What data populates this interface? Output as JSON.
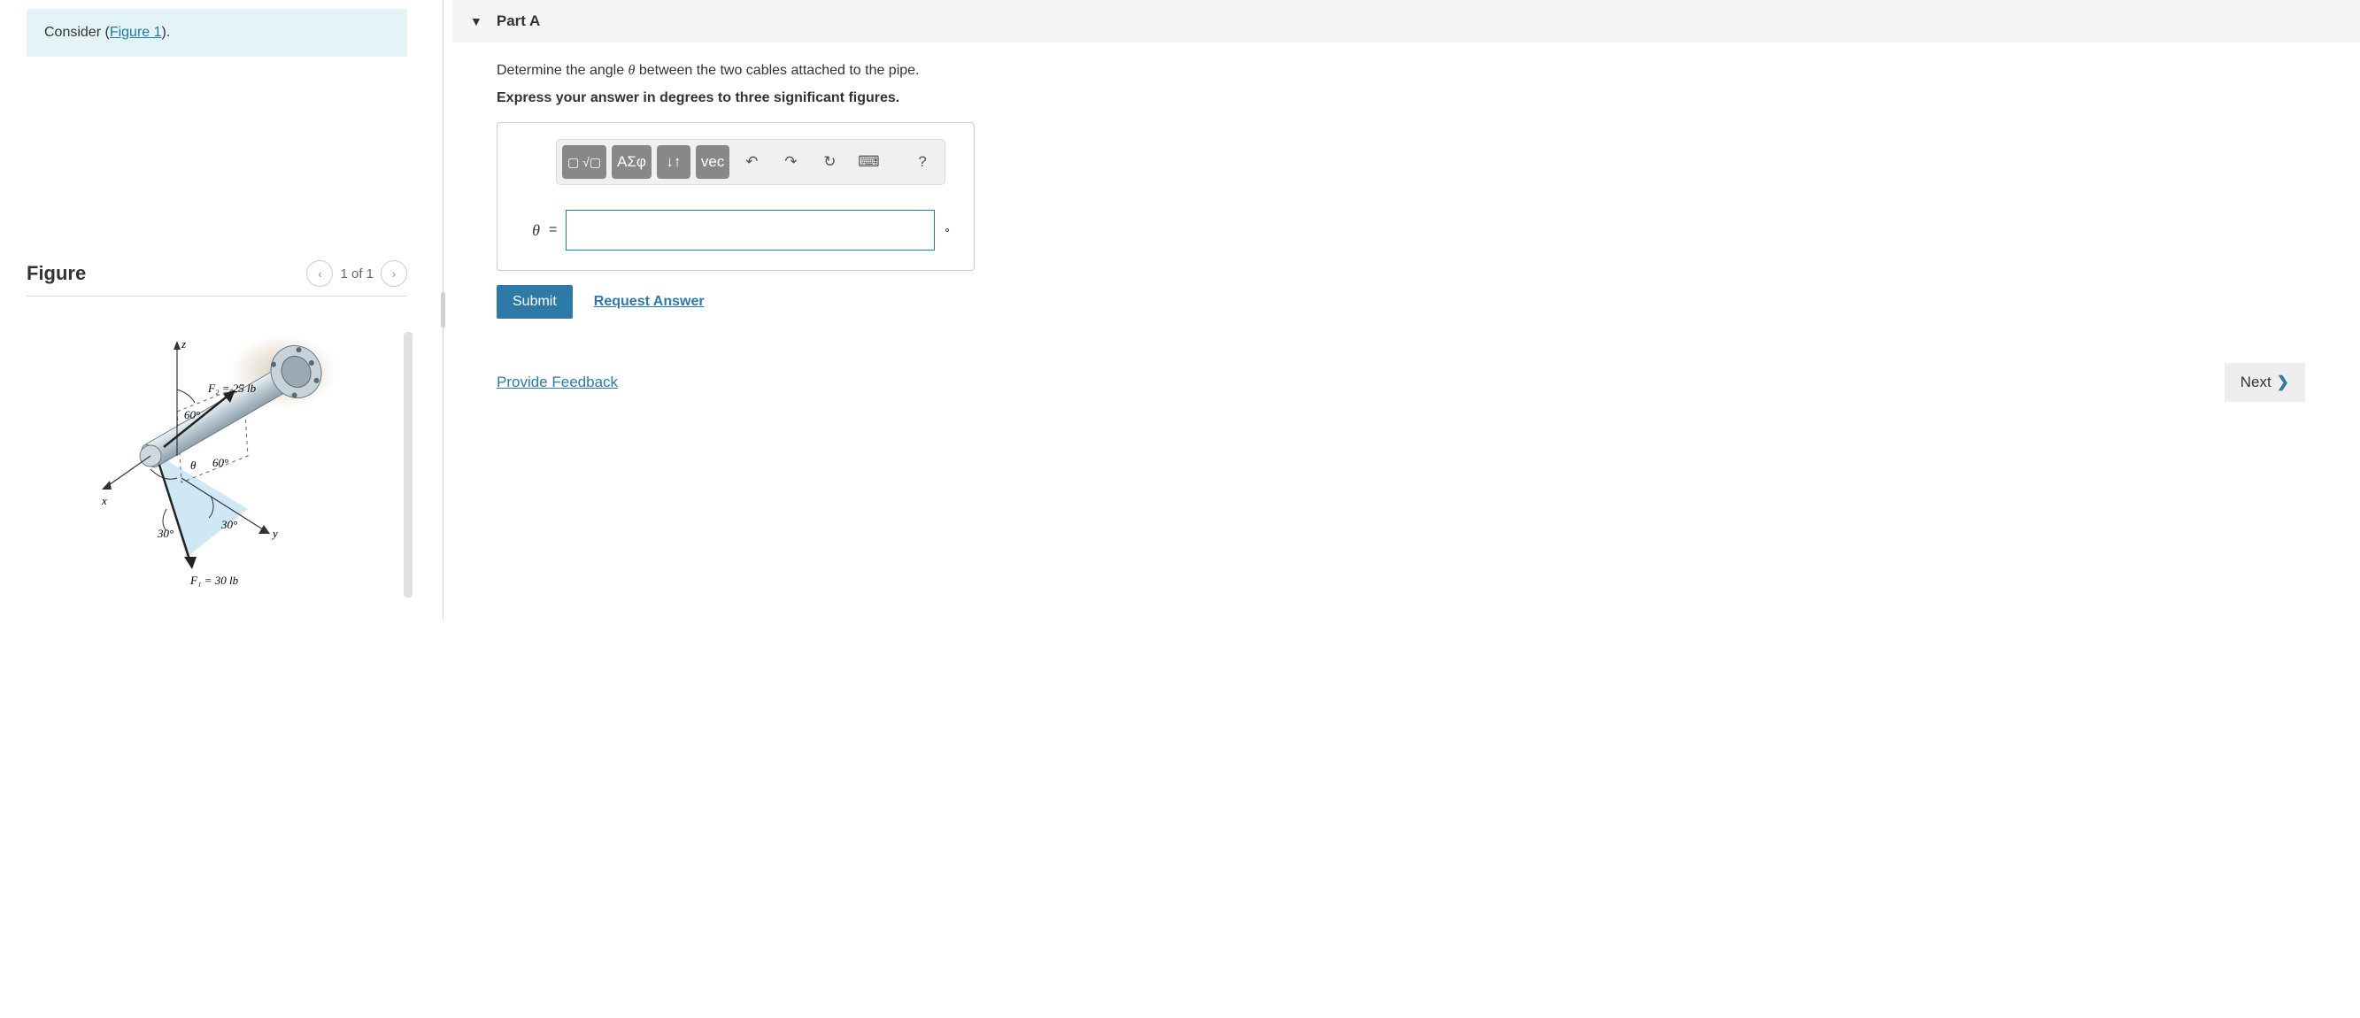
{
  "consider": {
    "prefix": "Consider (",
    "link_text": "Figure 1",
    "suffix": ")."
  },
  "figure": {
    "title": "Figure",
    "nav_label": "1 of 1",
    "labels": {
      "z": "z",
      "x": "x",
      "y": "y",
      "f2": "F₂ = 25 lb",
      "f1": "F₁ = 30 lb",
      "ang60a": "60°",
      "ang60b": "60°",
      "ang30a": "30°",
      "ang30b": "30°",
      "theta": "θ"
    }
  },
  "part": {
    "title": "Part A",
    "question_pre": "Determine the angle ",
    "question_var": "θ",
    "question_post": " between the two cables attached to the pipe.",
    "instruction": "Express your answer in degrees to three significant figures.",
    "toolbar": {
      "templates": "▭√▭",
      "greek": "ΑΣφ",
      "scinot": "↓↑",
      "vec": "vec",
      "undo": "↶",
      "redo": "↷",
      "reset": "↻",
      "keyboard": "⌨",
      "help": "?"
    },
    "var_label": "θ",
    "equals": "=",
    "unit": "∘",
    "submit": "Submit",
    "request": "Request Answer"
  },
  "footer": {
    "feedback": "Provide Feedback",
    "next": "Next"
  }
}
